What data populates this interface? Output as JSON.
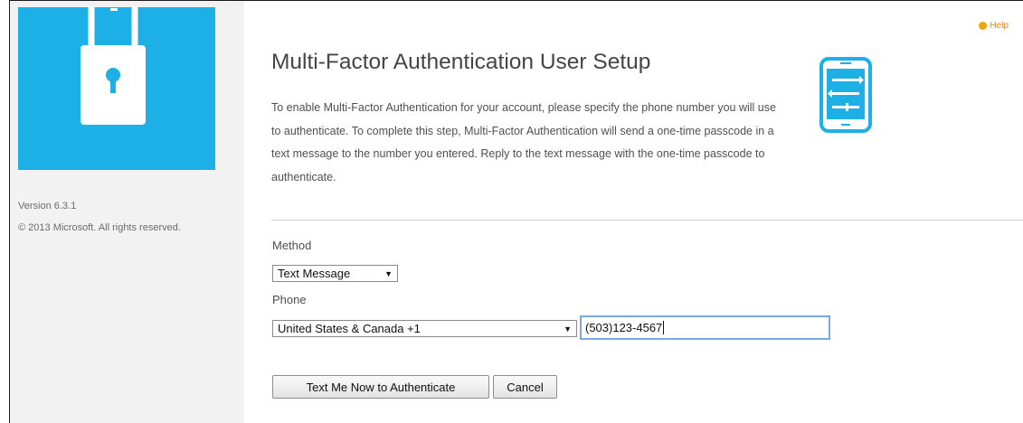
{
  "help": {
    "label": "Help"
  },
  "sidebar": {
    "version": "Version 6.3.1",
    "copyright": "© 2013 Microsoft. All rights reserved."
  },
  "main": {
    "title": "Multi-Factor Authentication User Setup",
    "description": "To enable Multi-Factor Authentication for your account, please specify the phone number you will use to authenticate. To complete this step, Multi-Factor Authentication will send a one-time passcode in a text message to the number you entered. Reply to the text message with the one-time passcode to authenticate."
  },
  "form": {
    "method_label": "Method",
    "method_value": "Text Message",
    "phone_label": "Phone",
    "country_value": "United States & Canada +1",
    "phone_value": "(503)123-4567"
  },
  "buttons": {
    "text_me": "Text Me Now to Authenticate",
    "cancel": "Cancel"
  },
  "icons": {
    "logo": "padlock-phone-icon",
    "setup": "phone-settings-icon",
    "help": "help-icon",
    "dropdown": "dropdown-caret-icon"
  },
  "colors": {
    "brand_blue": "#1cb0e6",
    "help_orange": "#f0a30a",
    "focus_border": "#7aa7e6"
  }
}
